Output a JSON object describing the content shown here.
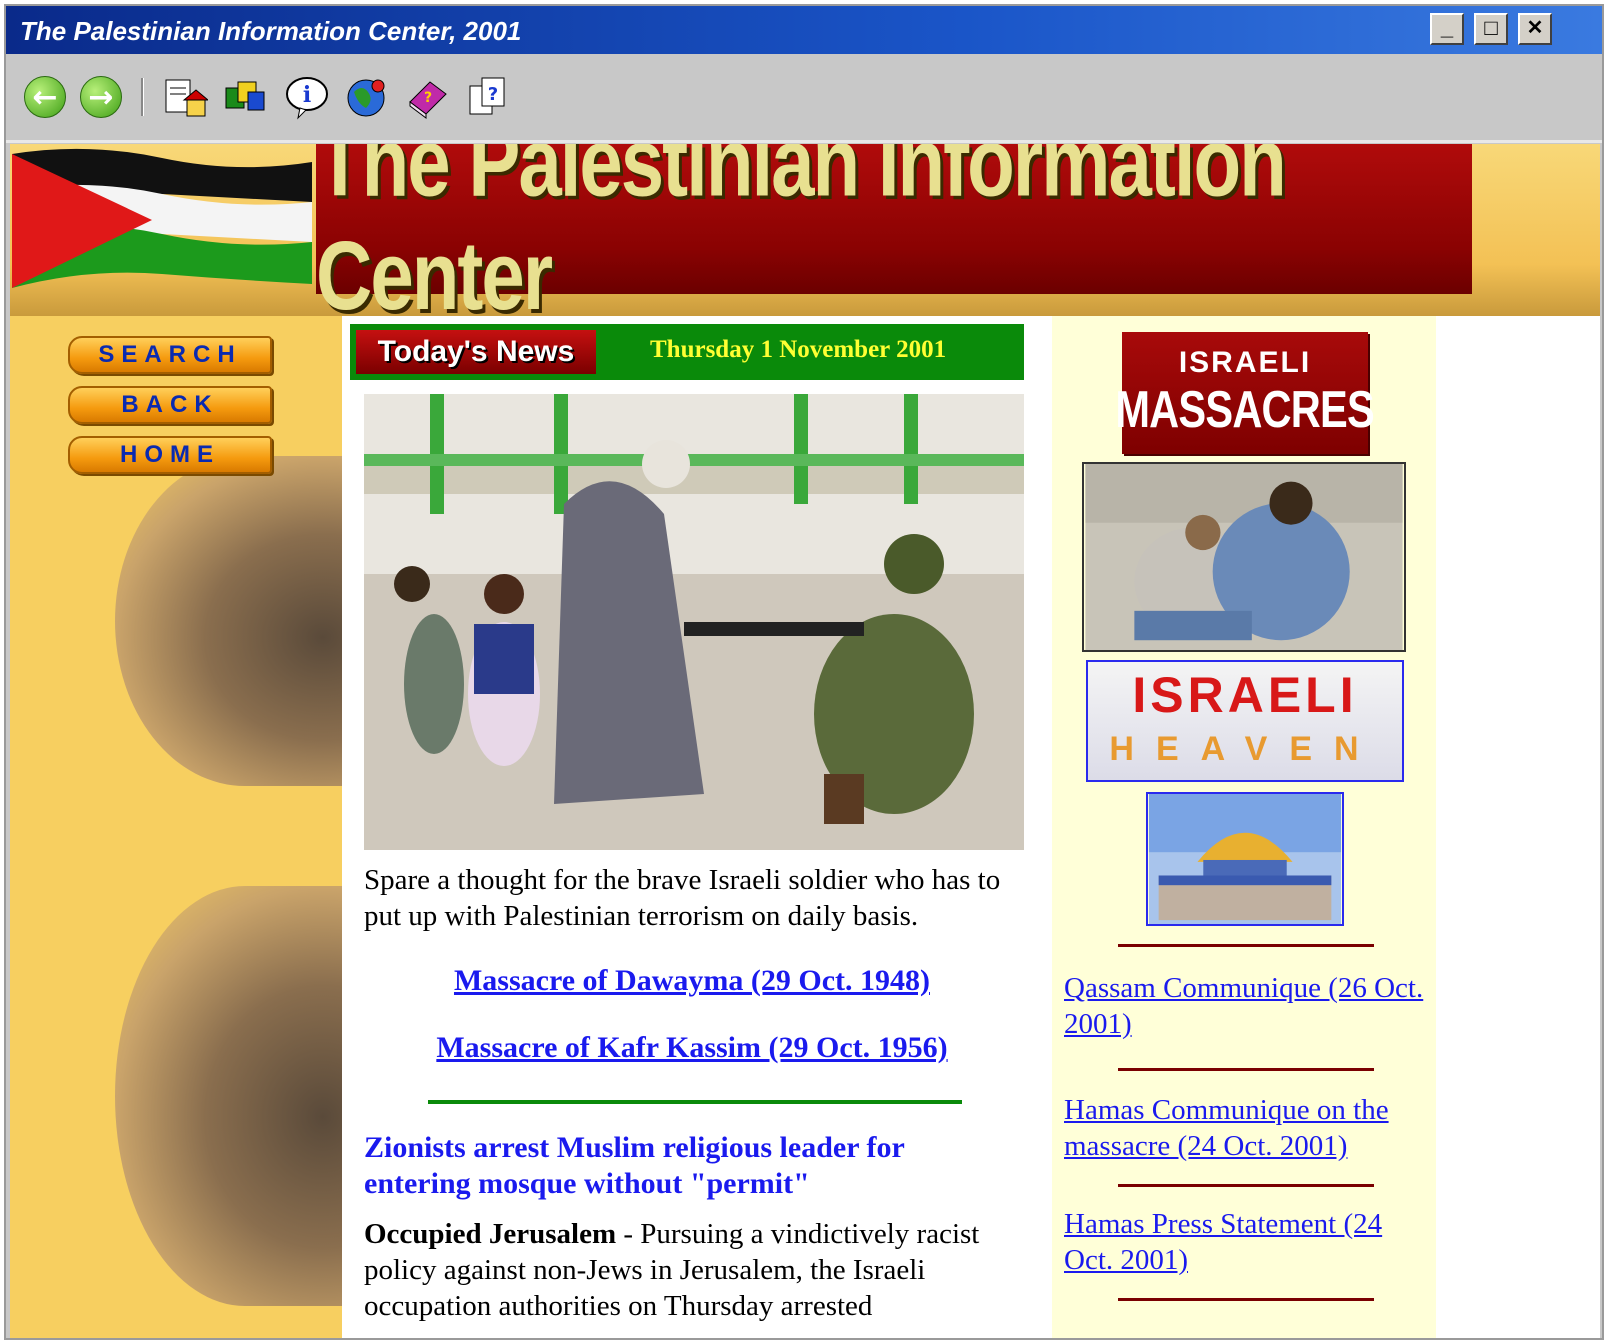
{
  "window": {
    "title": "The Palestinian Information Center, 2001",
    "minimize": "_",
    "maximize": "□",
    "close": "✕"
  },
  "toolbar": {
    "back_icon": "arrow-left-icon",
    "forward_icon": "arrow-right-icon",
    "home_icon": "home-page-icon",
    "links_icon": "links-icon",
    "info_icon": "info-icon",
    "globe_icon": "globe-icon",
    "book_icon": "book-icon",
    "help_icon": "help-icon"
  },
  "banner": {
    "title": "The Palestinian Information Center"
  },
  "nav": {
    "search": "SEARCH",
    "back": "BACK",
    "home": "HOME"
  },
  "news": {
    "badge": "Today's News",
    "date": "Thursday 1 November  2001",
    "caption": "Spare a thought for the brave Israeli soldier who has to put up with Palestinian terrorism on daily basis.",
    "link1": "Massacre of Dawayma (29 Oct. 1948)",
    "link2": "Massacre of Kafr Kassim (29 Oct. 1956)",
    "headline": "Zionists arrest Muslim religious leader  for entering mosque without \"permit\"",
    "dateline": "Occupied Jerusalem",
    "body": " - Pursuing a vindictively racist policy against non-Jews in Jerusalem, the Israeli occupation authorities on Thursday arrested"
  },
  "sidebar": {
    "massacres_top": "ISRAELI",
    "massacres_bottom": "MASSACRES",
    "heaven_top": "ISRAELI",
    "heaven_bottom": "HEAVEN",
    "links": [
      "Qassam Communique (26 Oct. 2001)",
      "Hamas Communique on the massacre (24 Oct. 2001)",
      "Hamas Press Statement (24 Oct. 2001)"
    ]
  },
  "colors": {
    "titlebar": "#0a2a8a",
    "page_bg": "#f7cf60",
    "link": "#1a1aee",
    "banner_red": "#8a0202",
    "news_green": "#0a8a0a",
    "date_yellow": "#ffff33"
  }
}
